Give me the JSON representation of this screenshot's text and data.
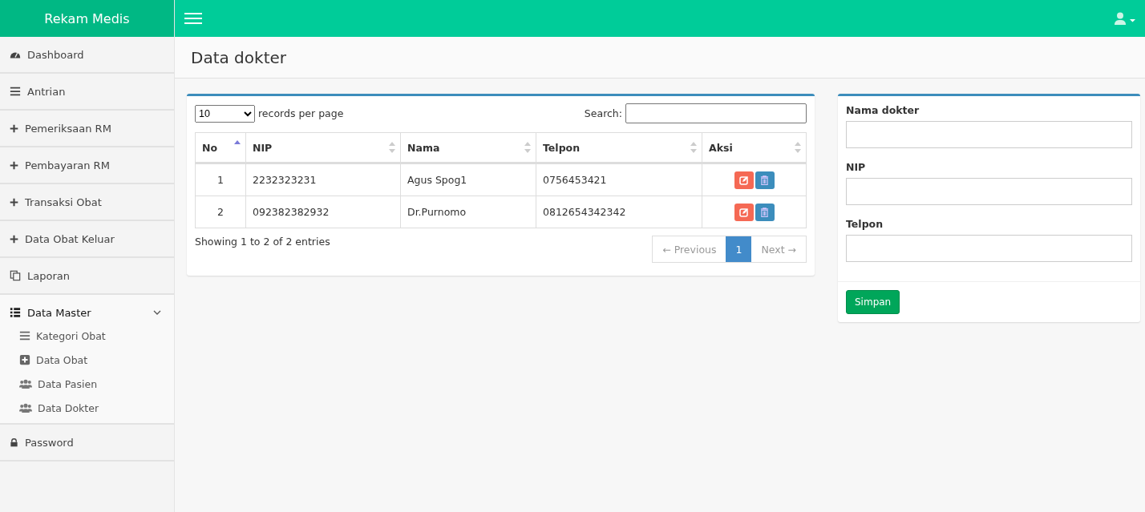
{
  "brand": "Rekam Medis",
  "sidebar": {
    "items": [
      {
        "label": "Dashboard",
        "kind": "dashboard"
      },
      {
        "label": "Antrian",
        "kind": "bars"
      },
      {
        "label": "Pemeriksaan RM",
        "kind": "plus"
      },
      {
        "label": "Pembayaran RM",
        "kind": "plus"
      },
      {
        "label": "Transaksi Obat",
        "kind": "plus"
      },
      {
        "label": "Data Obat Keluar",
        "kind": "plus"
      },
      {
        "label": "Laporan",
        "kind": "copy"
      },
      {
        "label": "Data Master",
        "kind": "table",
        "expanded": true,
        "children": [
          {
            "label": "Kategori Obat",
            "kind": "bars"
          },
          {
            "label": "Data Obat",
            "kind": "plussquare"
          },
          {
            "label": "Data Pasien",
            "kind": "users"
          },
          {
            "label": "Data Dokter",
            "kind": "users"
          }
        ]
      },
      {
        "label": "Password",
        "kind": "lock"
      }
    ]
  },
  "page_title": "Data dokter",
  "table_panel": {
    "page_size": "10",
    "page_size_label": "records per page",
    "search_label": "Search:",
    "columns": [
      {
        "label": "No",
        "sorted": true
      },
      {
        "label": "NIP",
        "sorted": false
      },
      {
        "label": "Nama",
        "sorted": false
      },
      {
        "label": "Telpon",
        "sorted": false
      },
      {
        "label": "Aksi",
        "sorted": false
      }
    ],
    "rows": [
      {
        "no": "1",
        "nip": "2232323231",
        "nama": "Agus Spog1",
        "telpon": "0756453421"
      },
      {
        "no": "2",
        "nip": "092382382932",
        "nama": "Dr.Purnomo",
        "telpon": "0812654342342"
      }
    ],
    "info": "Showing 1 to 2 of 2 entries",
    "pagination": {
      "previous": {
        "label": "← Previous",
        "disabled": true
      },
      "pages": [
        {
          "label": "1",
          "selected": true
        }
      ],
      "next": {
        "label": "Next →",
        "disabled": true
      }
    }
  },
  "form": {
    "fields": [
      {
        "label": "Nama dokter"
      },
      {
        "label": "NIP"
      },
      {
        "label": "Telpon"
      }
    ],
    "submit": "Simpan"
  }
}
